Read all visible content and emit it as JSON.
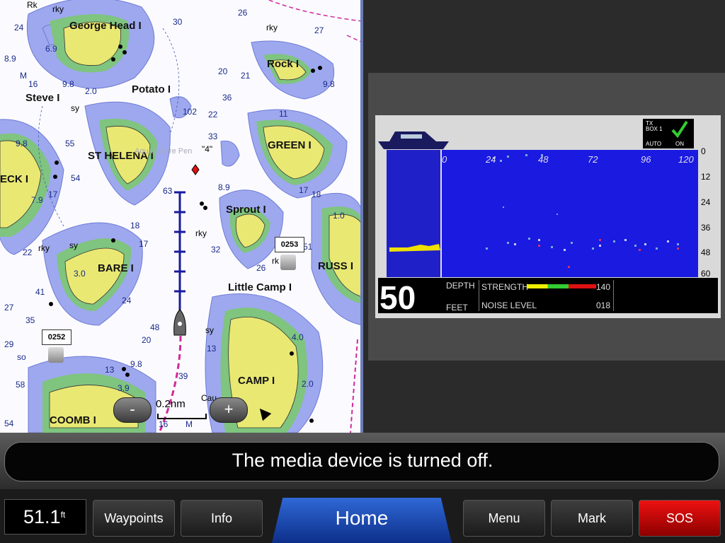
{
  "map": {
    "islands": [
      "George Head I",
      "Rock I",
      "Potato I",
      "Steve I",
      "ST HELENA I",
      "GREEN I",
      "ECK I",
      "Sprout I",
      "BARE I",
      "RUSS I",
      "Little Camp I",
      "CAMP I",
      "COOMB I"
    ],
    "depths": [
      "24",
      "26",
      "30",
      "27",
      "6.9",
      "8.9",
      "M",
      "16",
      "9.8",
      "2.0",
      "102",
      "22",
      "36",
      "21",
      "9.8",
      "20",
      "33",
      "55",
      "9.8",
      "54",
      "17",
      "7.9",
      "18",
      "63",
      "8.9",
      "11",
      "17",
      "18",
      "1.0",
      "22",
      "17",
      "32",
      "26",
      "51",
      "3.0",
      "24",
      "41",
      "27",
      "35",
      "20",
      "48",
      "29",
      "so",
      "58",
      "13",
      "9.8",
      "3.9",
      "13",
      "39",
      "16",
      "M",
      "54",
      "4.0",
      "2.0"
    ],
    "other_labels": [
      "Rk",
      "rky",
      "sy",
      "rky",
      "rky",
      "sy",
      "Aquaculture Pen",
      "\"4\"",
      "rky",
      "sy",
      "rk",
      "Cau"
    ],
    "waypoints": [
      {
        "id": "0253"
      },
      {
        "id": "0252"
      }
    ],
    "zoom_out": "-",
    "zoom_in": "+",
    "scale": "0.2nm"
  },
  "sonar": {
    "tx_line1": "TX",
    "tx_line2": "BOX 1",
    "tx_auto": "AUTO",
    "tx_on": "ON",
    "top_scale": [
      "0",
      "24",
      "48",
      "72",
      "96",
      "120"
    ],
    "right_scale": [
      "0",
      "12",
      "24",
      "36",
      "48",
      "60"
    ],
    "depth_value": "50",
    "depth_label": "DEPTH",
    "feet_label": "FEET",
    "strength_label": "STRENGTH",
    "strength_value": "140",
    "noise_label": "NOISE LEVEL",
    "noise_value": "018"
  },
  "message": "The media device is turned off.",
  "toolbar": {
    "readout": "51.1",
    "readout_unit": "ft",
    "waypoints": "Waypoints",
    "info": "Info",
    "home": "Home",
    "menu": "Menu",
    "mark": "Mark",
    "sos": "SOS"
  },
  "colors": {
    "land": "#e9e873",
    "shallow": "#9ea8ee",
    "sonar_bg": "#1a1ae0",
    "home": "#1a4fc0",
    "sos": "#c00000"
  }
}
